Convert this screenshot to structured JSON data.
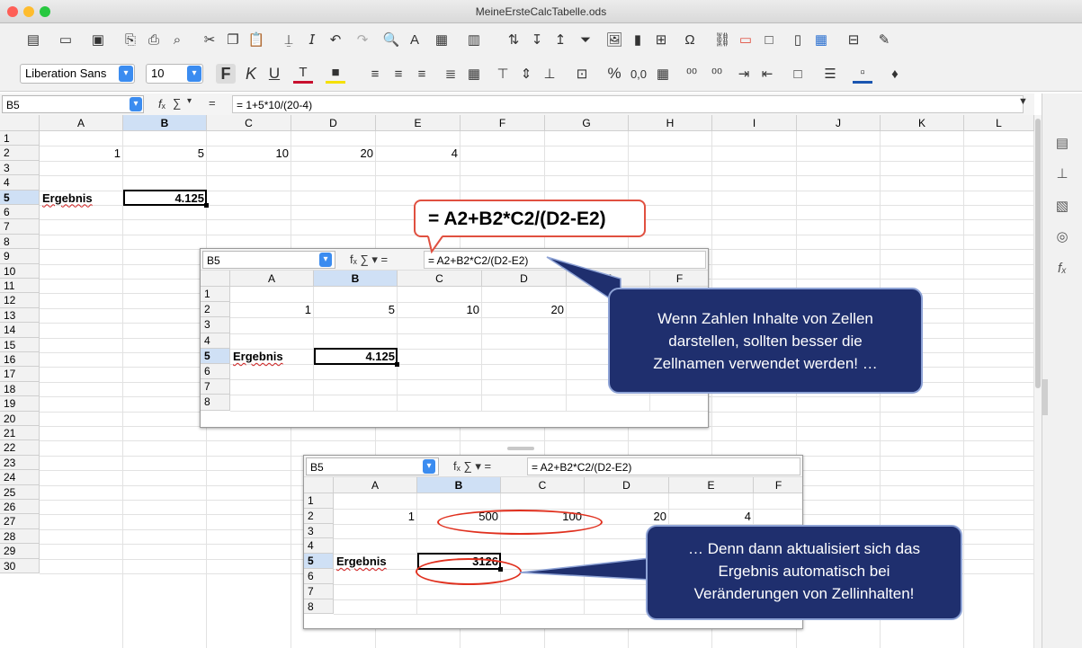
{
  "window": {
    "title": "MeineErsteCalcTabelle.ods"
  },
  "toolbar2": {
    "font_name": "Liberation Sans",
    "font_size": "10",
    "bold": "F",
    "italic": "K",
    "underline": "U",
    "percent": "%",
    "decimal": "0,0"
  },
  "formula_bar": {
    "cell_ref": "B5",
    "fx": "f",
    "sum": "∑",
    "equals": "=",
    "formula": "= 1+5*10/(20-4)"
  },
  "columns": [
    "A",
    "B",
    "C",
    "D",
    "E",
    "F",
    "G",
    "H",
    "I",
    "J",
    "K",
    "L"
  ],
  "rows": [
    "1",
    "2",
    "3",
    "4",
    "5",
    "6",
    "7",
    "8",
    "9",
    "10",
    "11",
    "12",
    "13",
    "14",
    "15",
    "16",
    "17",
    "18",
    "19",
    "20",
    "21",
    "22",
    "23",
    "24",
    "25",
    "26",
    "27",
    "28",
    "29",
    "30"
  ],
  "main_cells": {
    "A2": "1",
    "B2": "5",
    "C2": "10",
    "D2": "20",
    "E2": "4",
    "A5": "Ergebnis",
    "B5": "4.125"
  },
  "callout_formula": "= A2+B2*C2/(D2-E2)",
  "embed1": {
    "cell_ref": "B5",
    "formula": "= A2+B2*C2/(D2-E2)",
    "columns": [
      "A",
      "B",
      "C",
      "D",
      "E",
      "F"
    ],
    "rows": [
      "1",
      "2",
      "3",
      "4",
      "5",
      "6",
      "7",
      "8"
    ],
    "cells": {
      "A2": "1",
      "B2": "5",
      "C2": "10",
      "D2": "20",
      "A5": "Ergebnis",
      "B5": "4.125"
    }
  },
  "embed2": {
    "cell_ref": "B5",
    "formula": "= A2+B2*C2/(D2-E2)",
    "columns": [
      "A",
      "B",
      "C",
      "D",
      "E",
      "F"
    ],
    "rows": [
      "1",
      "2",
      "3",
      "4",
      "5",
      "6",
      "7",
      "8"
    ],
    "cells": {
      "A2": "1",
      "B2": "500",
      "C2": "100",
      "D2": "20",
      "E2": "4",
      "A5": "Ergebnis",
      "B5": "3126"
    }
  },
  "bubble1": {
    "line1": "Wenn Zahlen Inhalte von Zellen",
    "line2": "darstellen, sollten besser die",
    "line3": "Zellnamen verwendet werden! …"
  },
  "bubble2": {
    "line1": "… Denn dann aktualisiert sich das",
    "line2": "Ergebnis automatisch bei",
    "line3": "Veränderungen von Zellinhalten!"
  },
  "colors": {
    "accent": "#3b8cf0",
    "bubble": "#1f2f6e",
    "highlight_red": "#e0301e"
  }
}
